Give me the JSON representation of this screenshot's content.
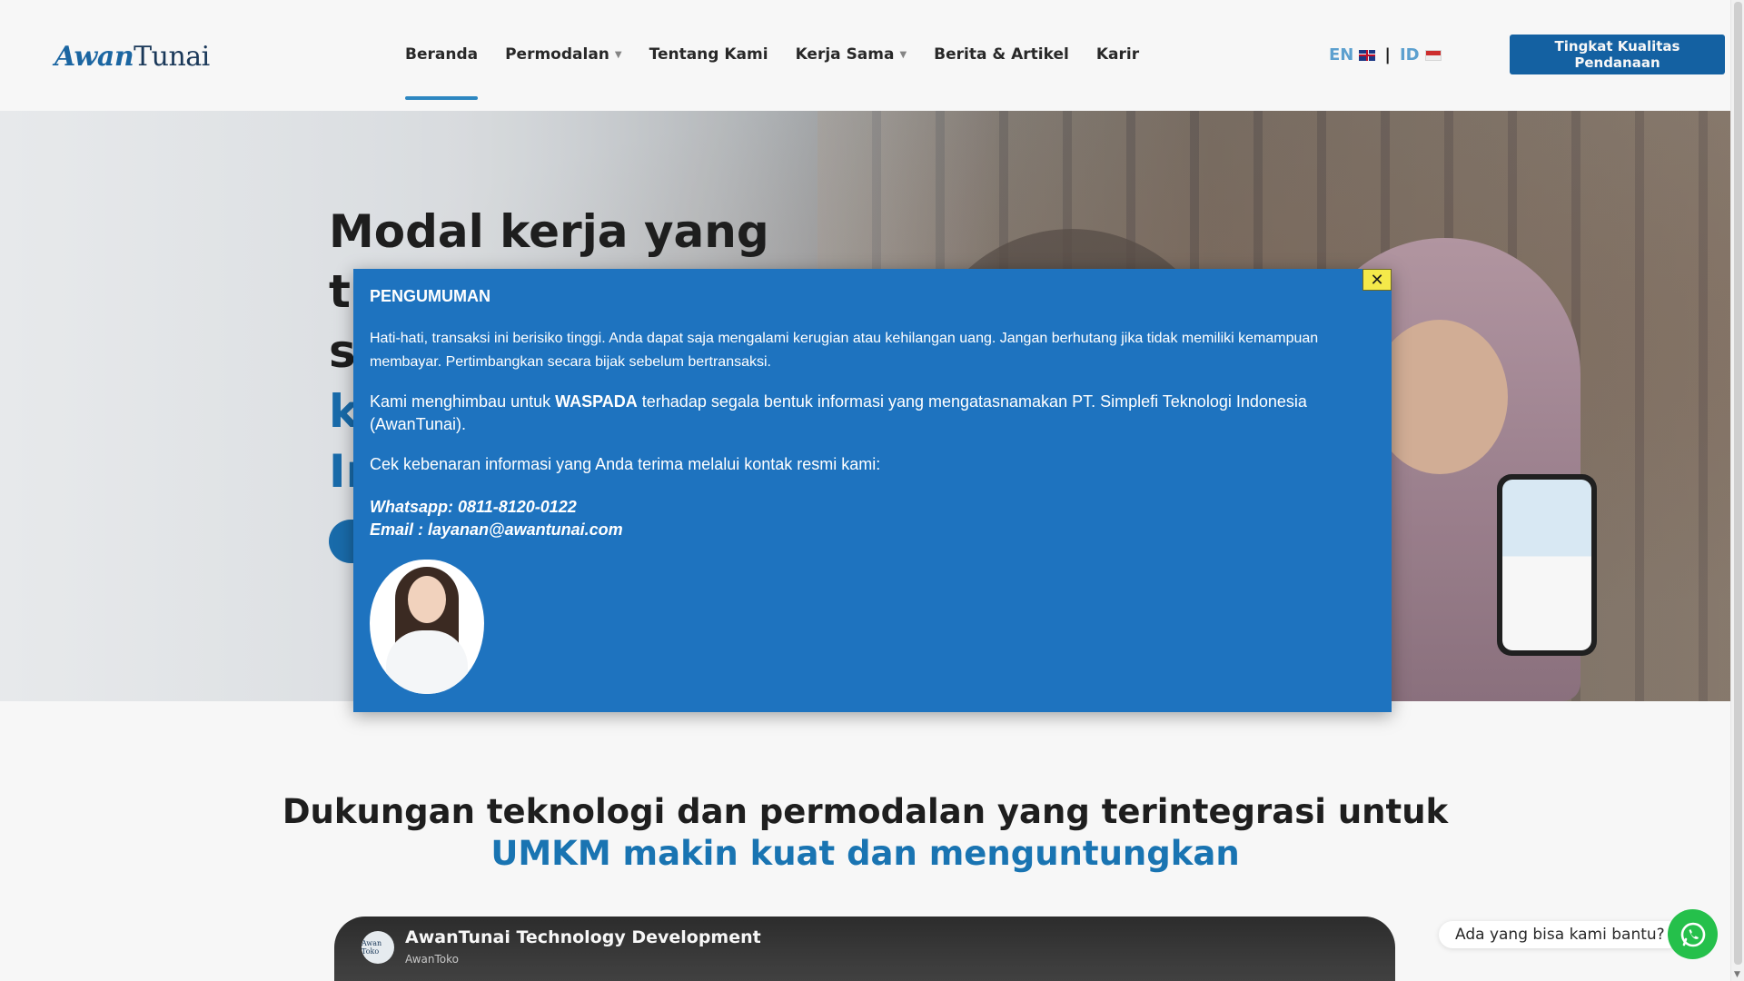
{
  "header": {
    "logo_text_a": "Awan",
    "logo_text_b": "Tunai",
    "nav": [
      {
        "label": "Beranda",
        "active": true,
        "dropdown": false
      },
      {
        "label": "Permodalan",
        "active": false,
        "dropdown": true
      },
      {
        "label": "Tentang Kami",
        "active": false,
        "dropdown": false
      },
      {
        "label": "Kerja Sama",
        "active": false,
        "dropdown": true
      },
      {
        "label": "Berita & Artikel",
        "active": false,
        "dropdown": false
      },
      {
        "label": "Karir",
        "active": false,
        "dropdown": false
      }
    ],
    "lang_en": "EN",
    "lang_sep": "|",
    "lang_id": "ID",
    "cta_label": "Tingkat Kualitas Pendanaan"
  },
  "hero": {
    "title_line1": "Modal kerja yang",
    "title_line2": "t",
    "title_line3": "s",
    "title_line4": "k",
    "title_line5": "In"
  },
  "section2": {
    "title_line1": "Dukungan teknologi dan permodalan yang terintegrasi untuk",
    "title_line2": "UMKM makin kuat dan menguntungkan",
    "video_title": "AwanTunai Technology Development",
    "video_channel": "AwanToko",
    "video_avatar_text": "Awan Toko"
  },
  "modal": {
    "heading": "PENGUMUMAN",
    "warning": "Hati-hati, transaksi ini berisiko tinggi. Anda dapat saja mengalami kerugian atau kehilangan uang. Jangan berhutang jika tidak memiliki kemampuan membayar. Pertimbangkan secara bijak sebelum bertransaksi.",
    "p2_before": "Kami menghimbau untuk ",
    "p2_bold": "WASPADA",
    "p2_after": " terhadap segala bentuk informasi yang mengatasnamakan PT. Simplefi Teknologi Indonesia (AwanTunai).",
    "p3": "Cek kebenaran informasi yang Anda terima melalui kontak resmi kami:",
    "whatsapp": "Whatsapp: 0811-8120-0122",
    "email": "Email : layanan@awantunai.com",
    "close_symbol": "✕"
  },
  "whatsapp_widget": {
    "label": "Ada yang bisa kami bantu?"
  },
  "colors": {
    "brand_blue": "#1565a8",
    "modal_blue": "#1e73bf",
    "close_yellow": "#f5e94a",
    "whatsapp_green": "#25c04b"
  }
}
